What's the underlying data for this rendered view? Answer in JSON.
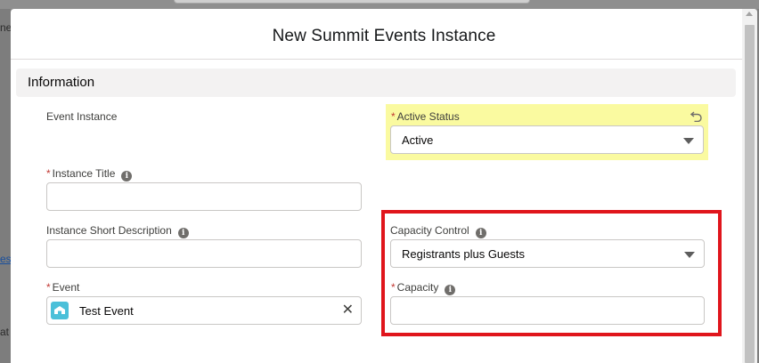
{
  "modal": {
    "title": "New Summit Events Instance"
  },
  "section": {
    "title": "Information"
  },
  "fields": {
    "event_instance": {
      "label": "Event Instance"
    },
    "active_status": {
      "label": "Active Status",
      "value": "Active"
    },
    "instance_title": {
      "label": "Instance Title",
      "value": ""
    },
    "instance_short_description": {
      "label": "Instance Short Description",
      "value": ""
    },
    "capacity_control": {
      "label": "Capacity Control",
      "value": "Registrants plus Guests"
    },
    "event": {
      "label": "Event",
      "value": "Test Event"
    },
    "capacity": {
      "label": "Capacity",
      "value": ""
    }
  },
  "symbols": {
    "required": "*",
    "info": "i",
    "clear": "✕"
  },
  "backdrop": {
    "left_fragment_1": "ne",
    "left_fragment_2": "es",
    "left_fragment_3": "at"
  },
  "icons": {
    "info": "info-icon",
    "undo": "undo-icon",
    "dropdown": "chevron-down-icon",
    "event_lookup": "event-object-icon",
    "clear": "close-icon"
  },
  "colors": {
    "required": "#c23934",
    "highlight_changed_field": "#fafaa0",
    "annotation_box": "#e0151c",
    "event_icon": "#4bc0d9"
  }
}
